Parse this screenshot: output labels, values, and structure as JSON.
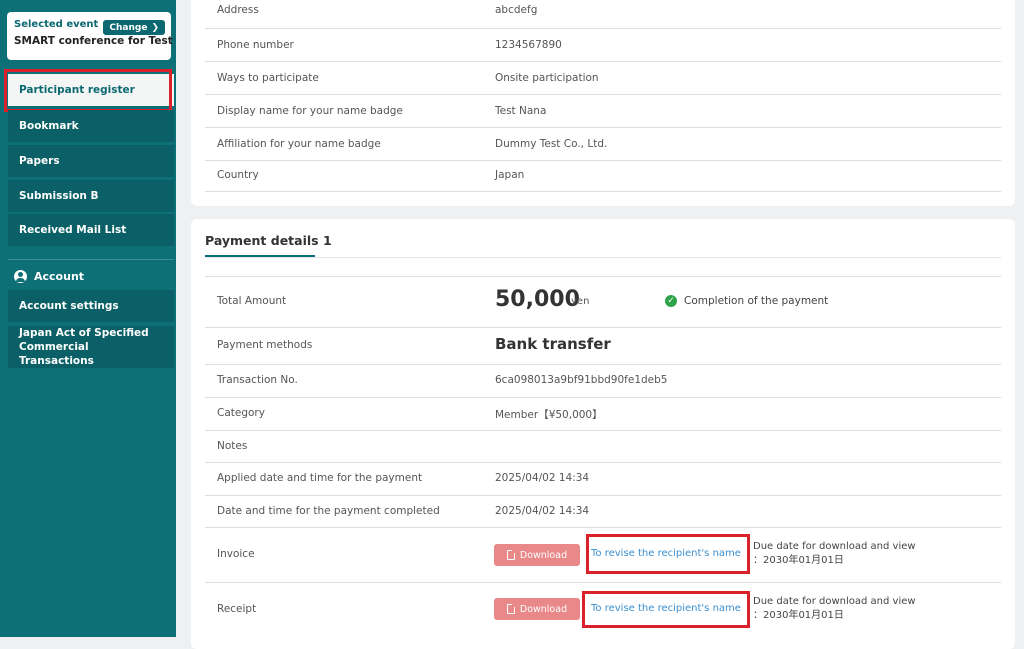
{
  "sidebar": {
    "selected_event_label": "Selected event",
    "change_label": "Change",
    "event_name": "SMART conference for Test",
    "items": [
      {
        "label": "Participant register"
      },
      {
        "label": "Bookmark"
      },
      {
        "label": "Papers"
      },
      {
        "label": "Submission B"
      },
      {
        "label": "Received Mail List"
      }
    ],
    "account_heading": "Account",
    "account_items": [
      {
        "label": "Account settings"
      },
      {
        "label": "Japan Act of Specified Commercial Transactions"
      }
    ]
  },
  "profile": {
    "rows": [
      {
        "label": "Address",
        "value": "abcdefg"
      },
      {
        "label": "Phone number",
        "value": "1234567890"
      },
      {
        "label": "Ways to participate",
        "value": "Onsite participation"
      },
      {
        "label": "Display name for your name badge",
        "value": "Test Nana"
      },
      {
        "label": "Affiliation for your name badge",
        "value": "Dummy Test Co., Ltd."
      },
      {
        "label": "Country",
        "value": "Japan"
      }
    ]
  },
  "payment": {
    "title": "Payment details 1",
    "total_label": "Total Amount",
    "total_value": "50,000",
    "currency": "yen",
    "status": "Completion of the payment",
    "method_label": "Payment methods",
    "method_value": "Bank transfer",
    "transaction_label": "Transaction No.",
    "transaction_value": "6ca098013a9bf91bbd90fe1deb5",
    "category_label": "Category",
    "category_value": "Member【¥50,000】",
    "notes_label": "Notes",
    "applied_label": "Applied date and time for the payment",
    "applied_value": "2025/04/02 14:34",
    "completed_label": "Date and time for the payment completed",
    "completed_value": "2025/04/02 14:34",
    "invoice_label": "Invoice",
    "receipt_label": "Receipt",
    "download_label": "Download",
    "revise_label": "To revise the recipient's name",
    "due_line1": "Due date for download and view",
    "due_line2": "：2030年01月01日"
  },
  "colors": {
    "sidebar": "#0d7076",
    "highlight": "#d9202b",
    "download": "#e88888",
    "link": "#3b8fd1",
    "success": "#2fa34a"
  }
}
